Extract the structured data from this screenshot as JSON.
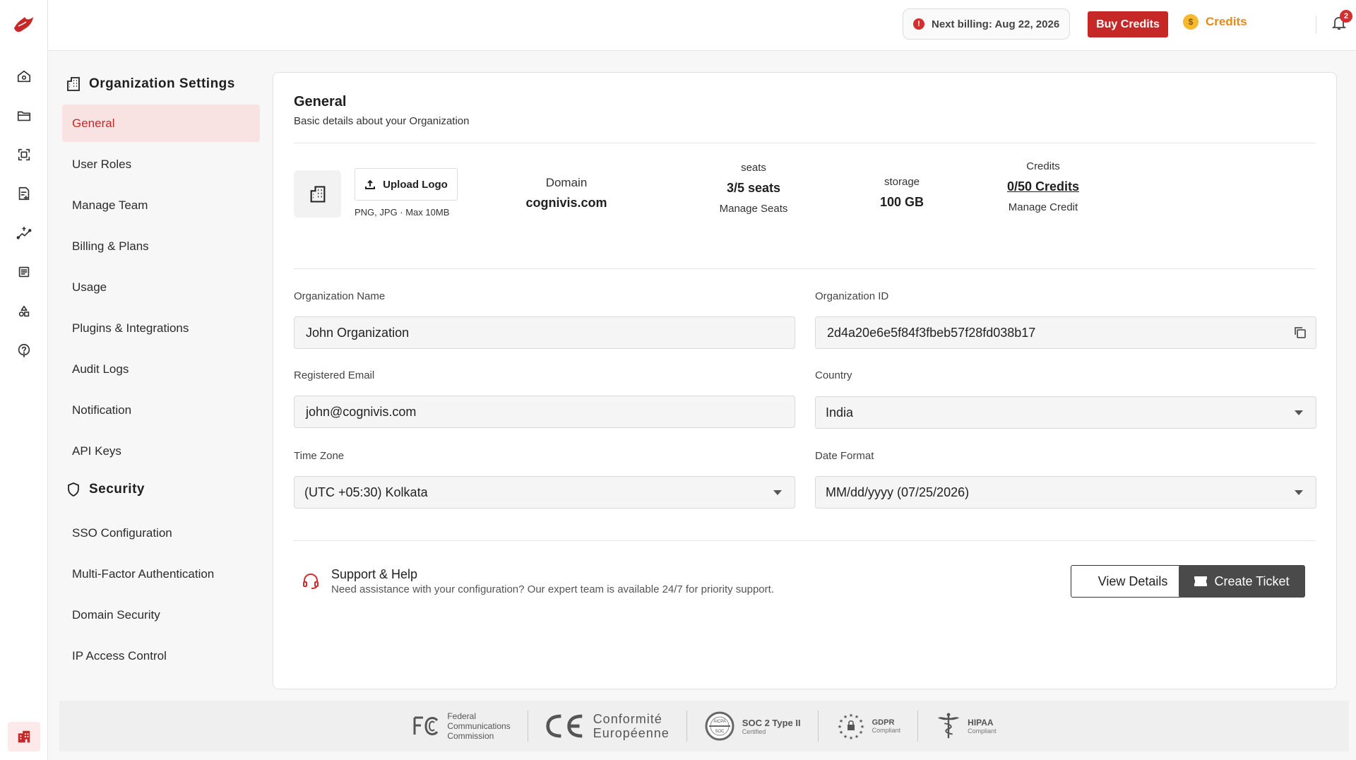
{
  "topbar": {
    "billing_text": "Next billing: Aug 22, 2026",
    "buy_credits_label": "Buy Credits",
    "credits_label": "Credits",
    "notification_count": "2"
  },
  "settings_nav": {
    "org_heading": "Organization Settings",
    "org_items": [
      "General",
      "User Roles",
      "Manage Team",
      "Billing & Plans",
      "Usage",
      "Plugins & Integrations",
      "Audit Logs",
      "Notification",
      "API Keys"
    ],
    "security_heading": "Security",
    "security_items": [
      "SSO Configuration",
      "Multi-Factor Authentication",
      "Domain Security",
      "IP Access Control"
    ],
    "active_item": "General"
  },
  "general": {
    "title": "General",
    "subtitle": "Basic details about your Organization",
    "upload_label": "Upload Logo",
    "upload_hint": "PNG, JPG · Max 10MB",
    "domain": {
      "label": "Domain",
      "value": "cognivis.com"
    },
    "seats": {
      "label": "seats",
      "value": "3/5 seats",
      "action": "Manage Seats"
    },
    "storage": {
      "label": "storage",
      "value": "100 GB"
    },
    "credits": {
      "label": "Credits",
      "value": "0/50 Credits",
      "action": "Manage Credit"
    }
  },
  "form": {
    "org_name": {
      "label": "Organization Name",
      "value": "John Organization"
    },
    "org_id": {
      "label": "Organization ID",
      "value": "2d4a20e6e5f84f3fbeb57f28fd038b17"
    },
    "email": {
      "label": "Registered Email",
      "value": "john@cognivis.com"
    },
    "country": {
      "label": "Country",
      "value": "India"
    },
    "timezone": {
      "label": "Time Zone",
      "value": "(UTC +05:30) Kolkata"
    },
    "date_format": {
      "label": "Date Format",
      "value": "MM/dd/yyyy (07/25/2026)"
    }
  },
  "support": {
    "title": "Support & Help",
    "description": "Need assistance with your configuration? Our expert team is available 24/7 for priority support.",
    "view_details_label": "View Details",
    "create_ticket_label": "Create Ticket"
  },
  "compliance": {
    "fcc": [
      "Federal",
      "Communications",
      "Commission"
    ],
    "ce": [
      "Conformité",
      "Européenne"
    ],
    "soc": {
      "title": "SOC 2 Type II",
      "sub": "Certified"
    },
    "gdpr": {
      "title": "GDPR",
      "sub": "Compliant"
    },
    "hipaa": {
      "title": "HIPAA",
      "sub": "Compliant"
    }
  },
  "colors": {
    "accent": "#c62828",
    "active_bg": "#f9e2e2",
    "credits": "#e58a1f"
  }
}
